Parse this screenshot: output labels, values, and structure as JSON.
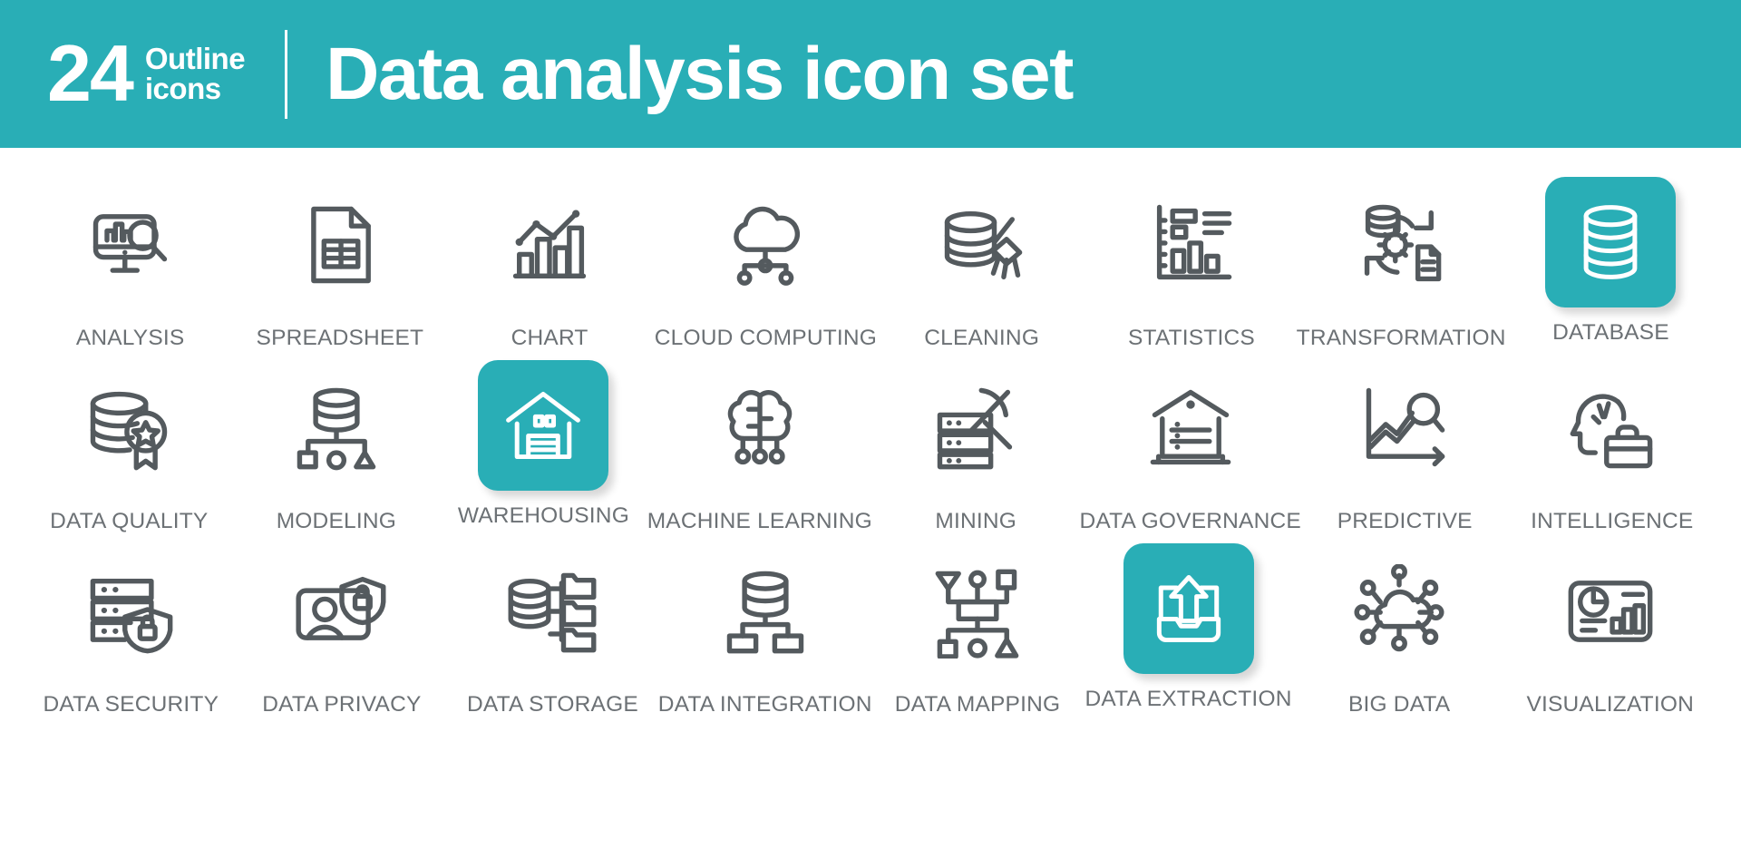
{
  "header": {
    "count": "24",
    "count_word_line1": "Outline",
    "count_word_line2": "icons",
    "title": "Data analysis icon set",
    "background_color": "#29aeb6",
    "text_color": "#ffffff"
  },
  "theme": {
    "accent_color": "#29aeb6",
    "icon_stroke_color": "#545a5e",
    "label_color": "#6c7175",
    "page_background": "#ffffff"
  },
  "grid": {
    "columns": 8,
    "rows": 3,
    "total_icons": 24,
    "rows_data": [
      [
        {
          "label": "ANALYSIS",
          "icon": "monitor-chart-search-icon",
          "highlighted": false
        },
        {
          "label": "SPREADSHEET",
          "icon": "document-table-icon",
          "highlighted": false
        },
        {
          "label": "CHART",
          "icon": "bar-line-chart-icon",
          "highlighted": false
        },
        {
          "label": "CLOUD COMPUTING",
          "icon": "cloud-nodes-icon",
          "highlighted": false
        },
        {
          "label": "CLEANING",
          "icon": "database-broom-icon",
          "highlighted": false
        },
        {
          "label": "STATISTICS",
          "icon": "statistics-bars-icon",
          "highlighted": false
        },
        {
          "label": "TRANSFORMATION",
          "icon": "database-gear-document-arrows-icon",
          "highlighted": false
        },
        {
          "label": "DATABASE",
          "icon": "database-cylinder-icon",
          "highlighted": true
        }
      ],
      [
        {
          "label": "DATA QUALITY",
          "icon": "database-star-badge-icon",
          "highlighted": false
        },
        {
          "label": "MODELING",
          "icon": "database-hierarchy-icon",
          "highlighted": false
        },
        {
          "label": "WAREHOUSING",
          "icon": "warehouse-icon",
          "highlighted": true
        },
        {
          "label": "MACHINE LEARNING",
          "icon": "brain-circuit-icon",
          "highlighted": false
        },
        {
          "label": "MINING",
          "icon": "server-pickaxe-icon",
          "highlighted": false
        },
        {
          "label": "DATA GOVERNANCE",
          "icon": "bank-building-icon",
          "highlighted": false
        },
        {
          "label": "PREDICTIVE",
          "icon": "trend-graph-magnifier-icon",
          "highlighted": false
        },
        {
          "label": "INTELLIGENCE",
          "icon": "head-briefcase-icon",
          "highlighted": false
        }
      ],
      [
        {
          "label": "DATA SECURITY",
          "icon": "server-lock-shield-icon",
          "highlighted": false
        },
        {
          "label": "DATA PRIVACY",
          "icon": "user-shield-lock-icon",
          "highlighted": false
        },
        {
          "label": "DATA STORAGE",
          "icon": "database-folders-icon",
          "highlighted": false
        },
        {
          "label": "DATA INTEGRATION",
          "icon": "database-branch-icon",
          "highlighted": false
        },
        {
          "label": "DATA MAPPING",
          "icon": "flow-mapping-icon",
          "highlighted": false
        },
        {
          "label": "DATA EXTRACTION",
          "icon": "upload-tray-arrow-icon",
          "highlighted": true
        },
        {
          "label": "BIG DATA",
          "icon": "cloud-network-nodes-icon",
          "highlighted": false
        },
        {
          "label": "VISUALIZATION",
          "icon": "dashboard-pie-bars-icon",
          "highlighted": false
        }
      ]
    ]
  }
}
